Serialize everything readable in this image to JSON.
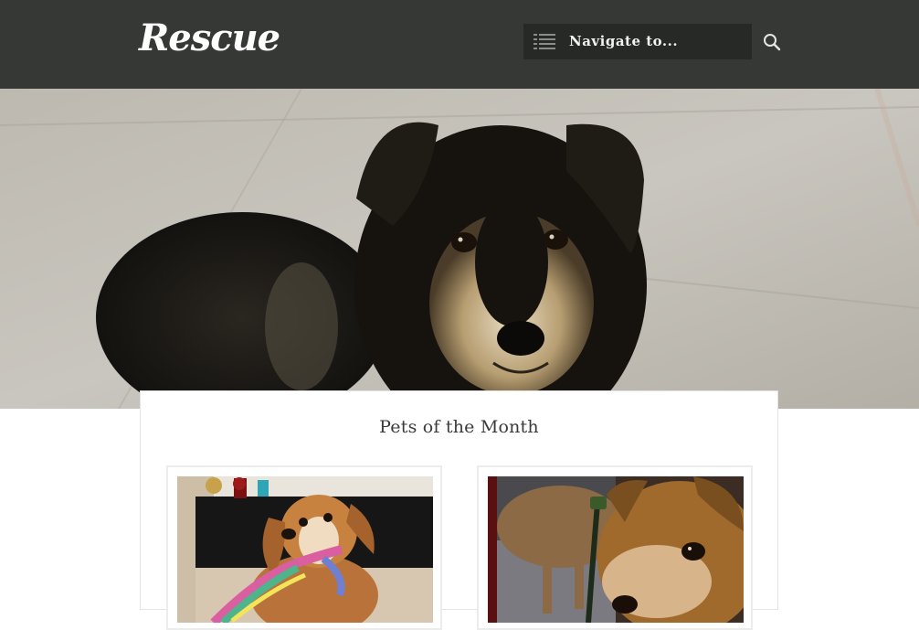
{
  "header": {
    "logo": "Rescue",
    "nav_label": "Navigate to..."
  },
  "hero": {
    "image": "puppy-photo"
  },
  "pets_section": {
    "title": "Pets of the Month",
    "cards": [
      {
        "image": "dog-with-rope-toy-photo"
      },
      {
        "image": "chihuahua-photo"
      }
    ]
  },
  "colors": {
    "header_bg": "#363836",
    "nav_bg": "#272927",
    "title_text": "#3a3a3a",
    "card_border": "#e4e4e4"
  }
}
